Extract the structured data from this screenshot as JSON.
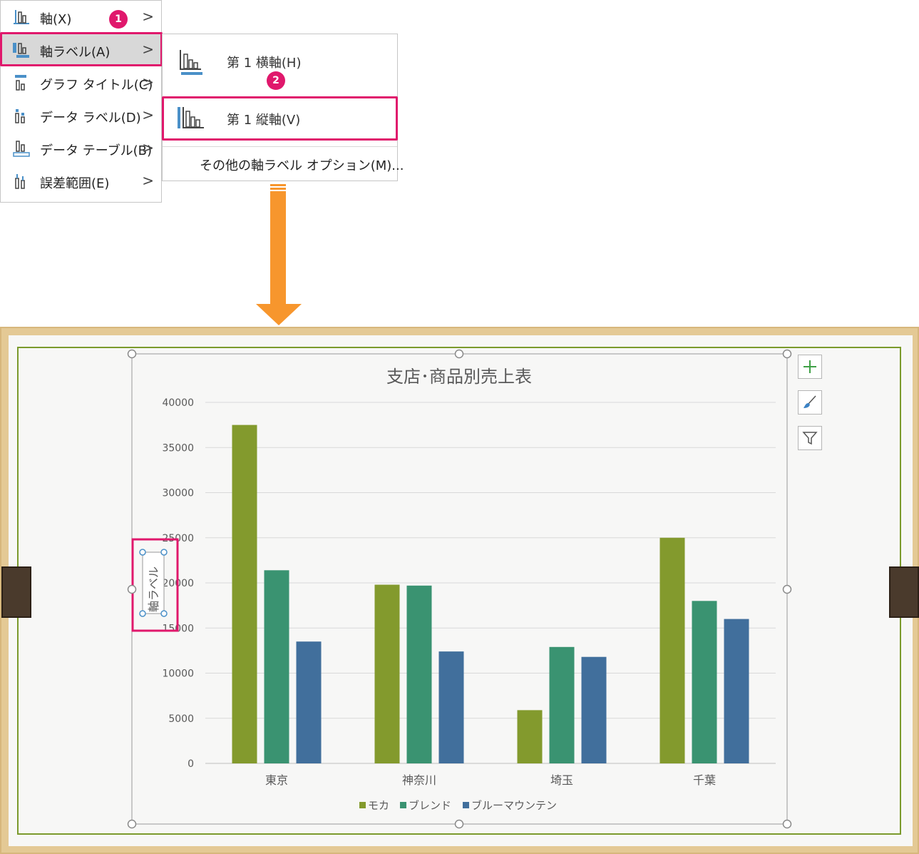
{
  "menu": {
    "items": [
      {
        "label": "軸(X)",
        "icon": "axes-icon"
      },
      {
        "label": "軸ラベル(A)",
        "icon": "axis-titles-icon"
      },
      {
        "label": "グラフ タイトル(C)",
        "icon": "chart-title-icon"
      },
      {
        "label": "データ ラベル(D)",
        "icon": "data-labels-icon"
      },
      {
        "label": "データ テーブル(B)",
        "icon": "data-table-icon"
      },
      {
        "label": "誤差範囲(E)",
        "icon": "error-bars-icon"
      }
    ],
    "arrow": ">"
  },
  "badges": {
    "first": "1",
    "second": "2"
  },
  "submenu": {
    "items": [
      {
        "label": "第 1 横軸(H)",
        "icon": "primary-horizontal-axis-title-icon"
      },
      {
        "label": "第 1 縦軸(V)",
        "icon": "primary-vertical-axis-title-icon"
      }
    ],
    "more": "その他の軸ラベル オプション(M)..."
  },
  "chart_side_buttons": [
    "chart-elements-plus-icon",
    "chart-styles-brush-icon",
    "chart-filters-icon"
  ],
  "colors": {
    "highlight": "#e0186c",
    "arrow": "#f7962d",
    "mocha": "#839a2d",
    "blend": "#3a9371",
    "blue_mountain": "#416f9c"
  },
  "chart_data": {
    "type": "bar",
    "title": "支店･商品別売上表",
    "categories": [
      "東京",
      "神奈川",
      "埼玉",
      "千葉"
    ],
    "series": [
      {
        "name": "モカ",
        "values": [
          37500,
          19800,
          5900,
          25000
        ]
      },
      {
        "name": "ブレンド",
        "values": [
          21400,
          19700,
          12900,
          18000
        ]
      },
      {
        "name": "ブルーマウンテン",
        "values": [
          13500,
          12400,
          11800,
          16000
        ]
      }
    ],
    "y_ticks": [
      "0",
      "5000",
      "10000",
      "15000",
      "20000",
      "25000",
      "30000",
      "35000",
      "40000"
    ],
    "ylim": [
      0,
      40000
    ],
    "ylabel": "軸ラベル",
    "legend": "bottom",
    "grid": true
  }
}
